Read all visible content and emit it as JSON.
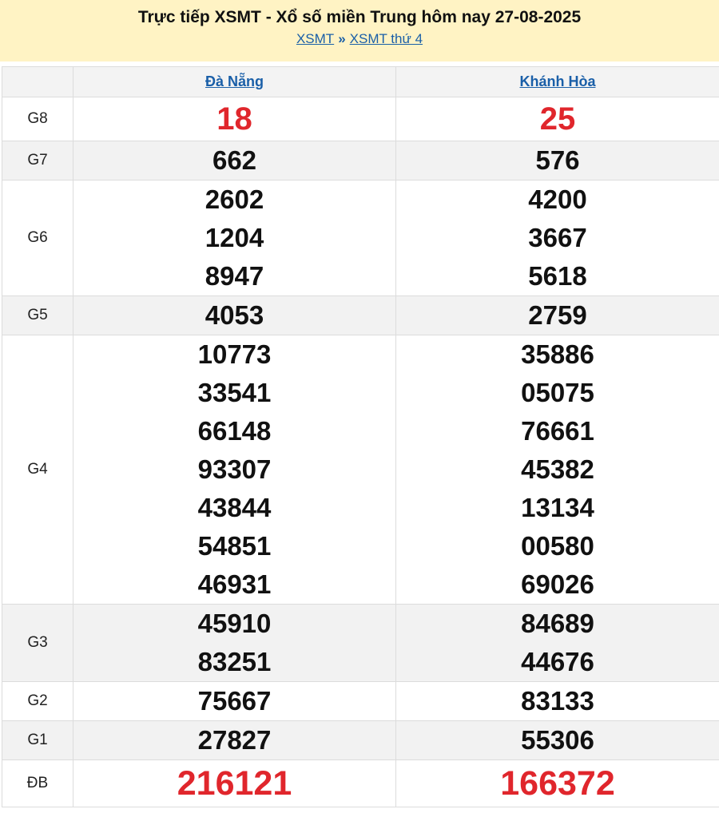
{
  "header": {
    "title": "Trực tiếp XSMT - Xổ số miền Trung hôm nay 27-08-2025",
    "breadcrumb": [
      {
        "label": "XSMT"
      },
      {
        "label": "XSMT thứ 4"
      }
    ],
    "separator": "»"
  },
  "provinces": [
    "Đà Nẵng",
    "Khánh Hòa"
  ],
  "prizes": [
    {
      "label": "G8",
      "cols": [
        [
          "18"
        ],
        [
          "25"
        ]
      ]
    },
    {
      "label": "G7",
      "cols": [
        [
          "662"
        ],
        [
          "576"
        ]
      ]
    },
    {
      "label": "G6",
      "cols": [
        [
          "2602",
          "1204",
          "8947"
        ],
        [
          "4200",
          "3667",
          "5618"
        ]
      ]
    },
    {
      "label": "G5",
      "cols": [
        [
          "4053"
        ],
        [
          "2759"
        ]
      ]
    },
    {
      "label": "G4",
      "cols": [
        [
          "10773",
          "33541",
          "66148",
          "93307",
          "43844",
          "54851",
          "46931"
        ],
        [
          "35886",
          "05075",
          "76661",
          "45382",
          "13134",
          "00580",
          "69026"
        ]
      ]
    },
    {
      "label": "G3",
      "cols": [
        [
          "45910",
          "83251"
        ],
        [
          "84689",
          "44676"
        ]
      ]
    },
    {
      "label": "G2",
      "cols": [
        [
          "75667"
        ],
        [
          "83133"
        ]
      ]
    },
    {
      "label": "G1",
      "cols": [
        [
          "27827"
        ],
        [
          "55306"
        ]
      ]
    },
    {
      "label": "ĐB",
      "cols": [
        [
          "216121"
        ],
        [
          "166372"
        ]
      ]
    }
  ],
  "colors": {
    "header_bg": "#fff3c4",
    "link": "#1a5fa8",
    "highlight_number": "#e0262c"
  }
}
